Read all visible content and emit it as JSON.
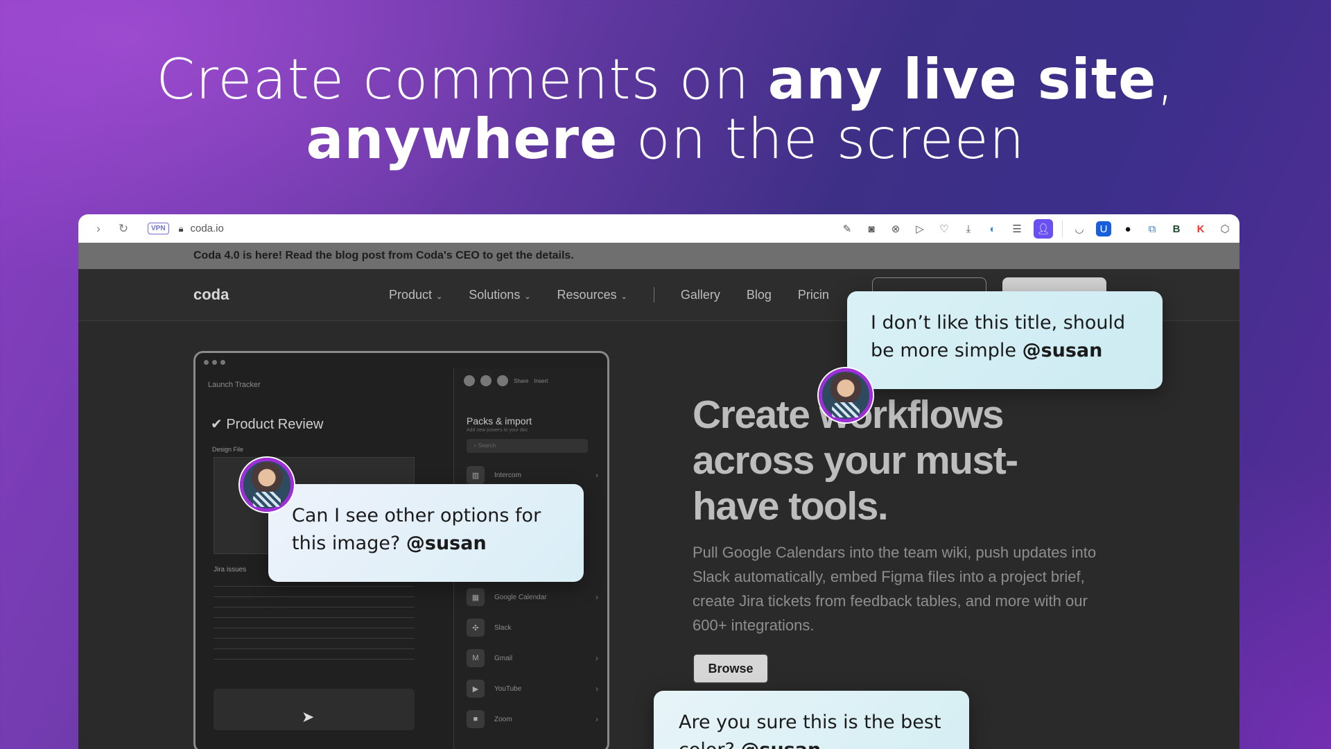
{
  "headline": {
    "line1_a": "Create comments on ",
    "line1_bold": "any live site",
    "line1_b": ",",
    "line2_bold": "anywhere",
    "line2_a": " on the screen"
  },
  "browser": {
    "back_icon": "chevron-right-icon",
    "reload_icon": "reload-icon",
    "vpn_label": "VPN",
    "url": "coda.io",
    "extensions": [
      "edit-icon",
      "camera-icon",
      "shield-icon",
      "play-icon",
      "heart-icon",
      "download-icon",
      "toggle-icon",
      "menu-icon",
      "profile-icon",
      "pocket-icon",
      "bitwarden-icon",
      "circle-icon",
      "translate-icon",
      "b-icon",
      "k-icon",
      "cube-icon"
    ]
  },
  "banner": {
    "text": "Coda 4.0 is here! Read the blog post from Coda's CEO to get the details."
  },
  "coda_nav": {
    "logo": "coda",
    "items": [
      "Product",
      "Solutions",
      "Resources",
      "Gallery",
      "Blog",
      "Pricin"
    ]
  },
  "app_mock": {
    "tracker": "Launch Tracker",
    "title": "Product Review",
    "design_file": "Design File",
    "jira_label": "Jira issues",
    "packs_title": "Packs & import",
    "packs_sub": "Add new powers to your doc",
    "search_placeholder": "Search",
    "share": "Share",
    "insert": "Insert",
    "packs": [
      {
        "name": "Intercom",
        "icon": "intercom-icon"
      },
      {
        "name": "",
        "icon": ""
      },
      {
        "name": "",
        "icon": ""
      },
      {
        "name": "",
        "icon": ""
      },
      {
        "name": "Google Calendar",
        "icon": "calendar-icon"
      },
      {
        "name": "Slack",
        "icon": "slack-icon"
      },
      {
        "name": "Gmail",
        "icon": "gmail-icon"
      },
      {
        "name": "YouTube",
        "icon": "youtube-icon"
      },
      {
        "name": "Zoom",
        "icon": "zoom-icon"
      }
    ]
  },
  "hero": {
    "title": "Create workflows across your must-have tools.",
    "body": "Pull Google Calendars into the team wiki, push updates into Slack automatically, embed Figma files into a project brief, create Jira tickets from feedback tables, and more with our 600+ integrations.",
    "browse": "Browse"
  },
  "comments": [
    {
      "text": "I don’t like this title, should be more simple ",
      "mention": "@susan"
    },
    {
      "text": "Can I see other options for this image? ",
      "mention": "@susan"
    },
    {
      "text": "Are you sure this is the best color? ",
      "mention": "@susan"
    }
  ]
}
